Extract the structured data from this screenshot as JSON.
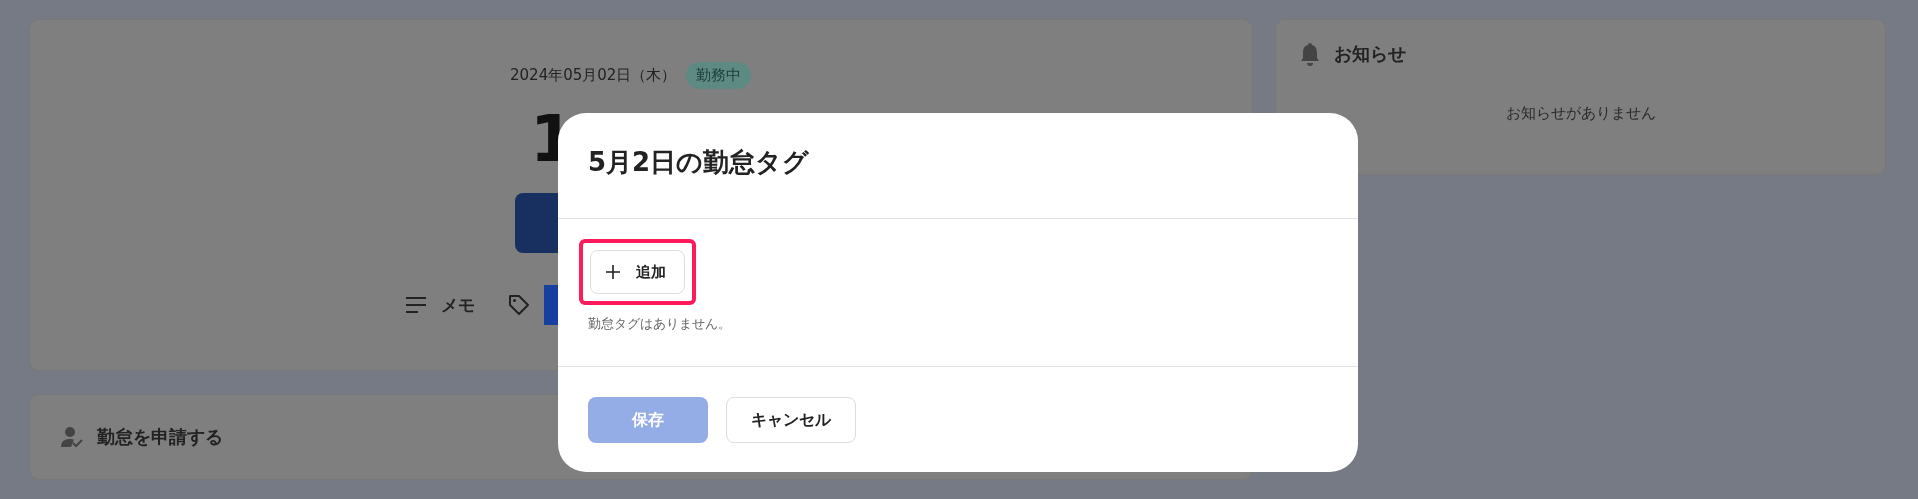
{
  "attendance_card": {
    "date": "2024年05月02日（木）",
    "status_badge": "勤務中",
    "time": "1",
    "memo_label": "メモ"
  },
  "request_card": {
    "title": "勤怠を申請する"
  },
  "notice_card": {
    "title": "お知らせ",
    "empty_message": "お知らせがありません"
  },
  "modal": {
    "title": "5月2日の勤怠タグ",
    "add_button": {
      "label": "追加",
      "highlighted": true
    },
    "empty_message": "勤怠タグはありません。",
    "buttons": [
      {
        "kind": "primary",
        "label": "保存",
        "disabled": true
      },
      {
        "kind": "secondary",
        "label": "キャンセル",
        "disabled": false
      }
    ]
  }
}
